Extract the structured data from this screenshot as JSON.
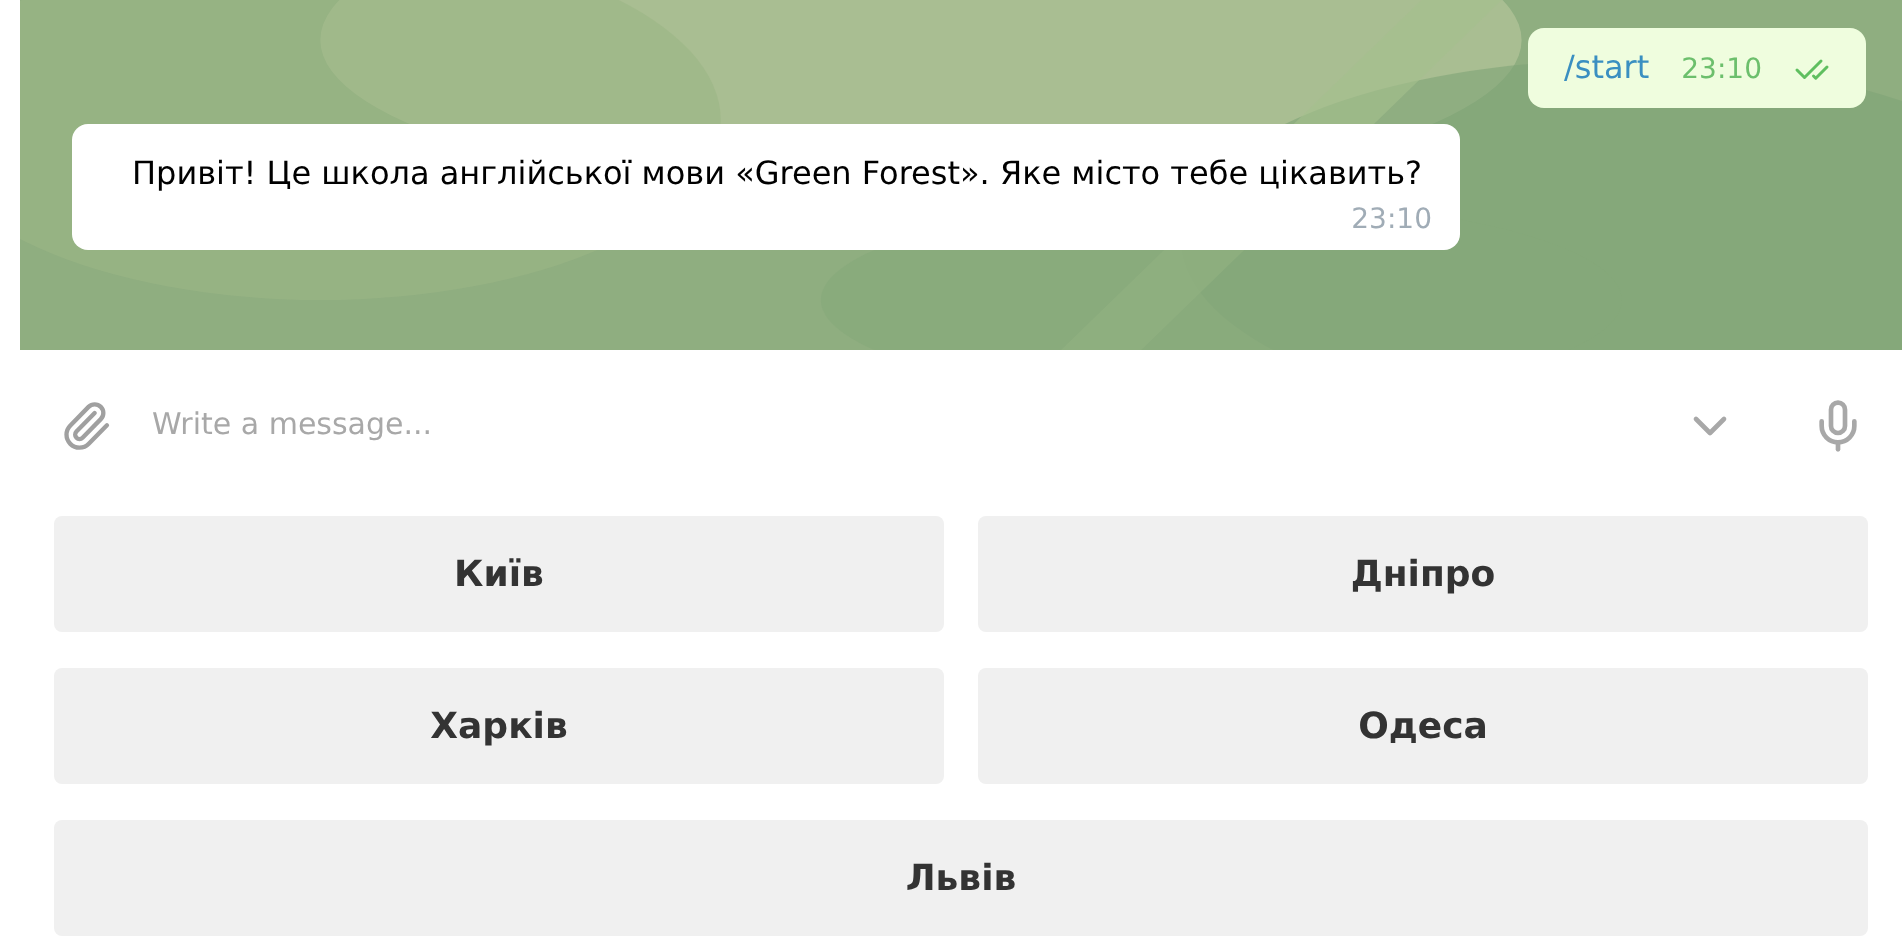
{
  "chat": {
    "messages": [
      {
        "kind": "outgoing",
        "text": "/start",
        "time": "23:10",
        "read": true
      },
      {
        "kind": "incoming",
        "text": "Привіт! Це школа англійської мови «Green Forest». Яке місто тебе цікавить?",
        "time": "23:10"
      }
    ]
  },
  "composer": {
    "placeholder": "Write a message..."
  },
  "keyboard": [
    [
      "Київ",
      "Дніпро"
    ],
    [
      "Харків",
      "Одеса"
    ],
    [
      "Львів"
    ]
  ]
}
